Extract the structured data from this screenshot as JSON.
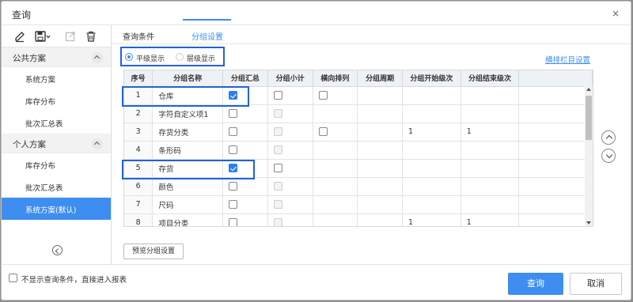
{
  "window": {
    "title": "查询",
    "close_glyph": "×"
  },
  "toolbar": {
    "icons": [
      "edit-icon",
      "save-icon",
      "export-icon",
      "delete-icon"
    ]
  },
  "sidebar": {
    "public": {
      "label": "公共方案",
      "items": [
        "系统方案",
        "库存分布",
        "批次汇总表"
      ]
    },
    "personal": {
      "label": "个人方案",
      "items": [
        "库存分布",
        "批次汇总表",
        "系统方案(默认)"
      ]
    },
    "active_item": "系统方案(默认)"
  },
  "tabs": [
    {
      "label": "查询条件",
      "active": false
    },
    {
      "label": "分组设置",
      "active": true
    }
  ],
  "display_mode": {
    "options": [
      "平级显示",
      "层级显示"
    ],
    "selected": "平级显示"
  },
  "column_settings_link": "横排栏目设置",
  "grid": {
    "headers": [
      "序号",
      "分组名称",
      "分组汇总",
      "分组小计",
      "横向排列",
      "分组周期",
      "分组开始级次",
      "分组结束级次"
    ],
    "rows": [
      {
        "no": "1",
        "name": "仓库",
        "summary": "checked",
        "subtotal": "unchecked",
        "horizontal": "unchecked",
        "period": "",
        "start": "",
        "end": ""
      },
      {
        "no": "2",
        "name": "字符自定义项1",
        "summary": "unchecked",
        "subtotal": "disabled",
        "horizontal": "",
        "period": "",
        "start": "",
        "end": ""
      },
      {
        "no": "3",
        "name": "存货分类",
        "summary": "unchecked",
        "subtotal": "disabled",
        "horizontal": "unchecked",
        "period": "",
        "start": "1",
        "end": "1"
      },
      {
        "no": "4",
        "name": "条形码",
        "summary": "unchecked",
        "subtotal": "disabled",
        "horizontal": "",
        "period": "",
        "start": "",
        "end": ""
      },
      {
        "no": "5",
        "name": "存货",
        "summary": "checked",
        "subtotal": "unchecked",
        "horizontal": "",
        "period": "",
        "start": "",
        "end": ""
      },
      {
        "no": "6",
        "name": "颜色",
        "summary": "unchecked",
        "subtotal": "disabled",
        "horizontal": "",
        "period": "",
        "start": "",
        "end": ""
      },
      {
        "no": "7",
        "name": "尺码",
        "summary": "unchecked",
        "subtotal": "disabled",
        "horizontal": "",
        "period": "",
        "start": "",
        "end": ""
      },
      {
        "no": "8",
        "name": "项目分类",
        "summary": "unchecked",
        "subtotal": "disabled",
        "horizontal": "",
        "period": "",
        "start": "1",
        "end": "1"
      }
    ]
  },
  "preview_button": "预览分组设置",
  "footer": {
    "skip_label": "不显示查询条件，直接进入报表",
    "query_button": "查询",
    "cancel_button": "取消"
  },
  "colors": {
    "accent": "#3d8ef0",
    "highlight_border": "#1f63d8"
  }
}
